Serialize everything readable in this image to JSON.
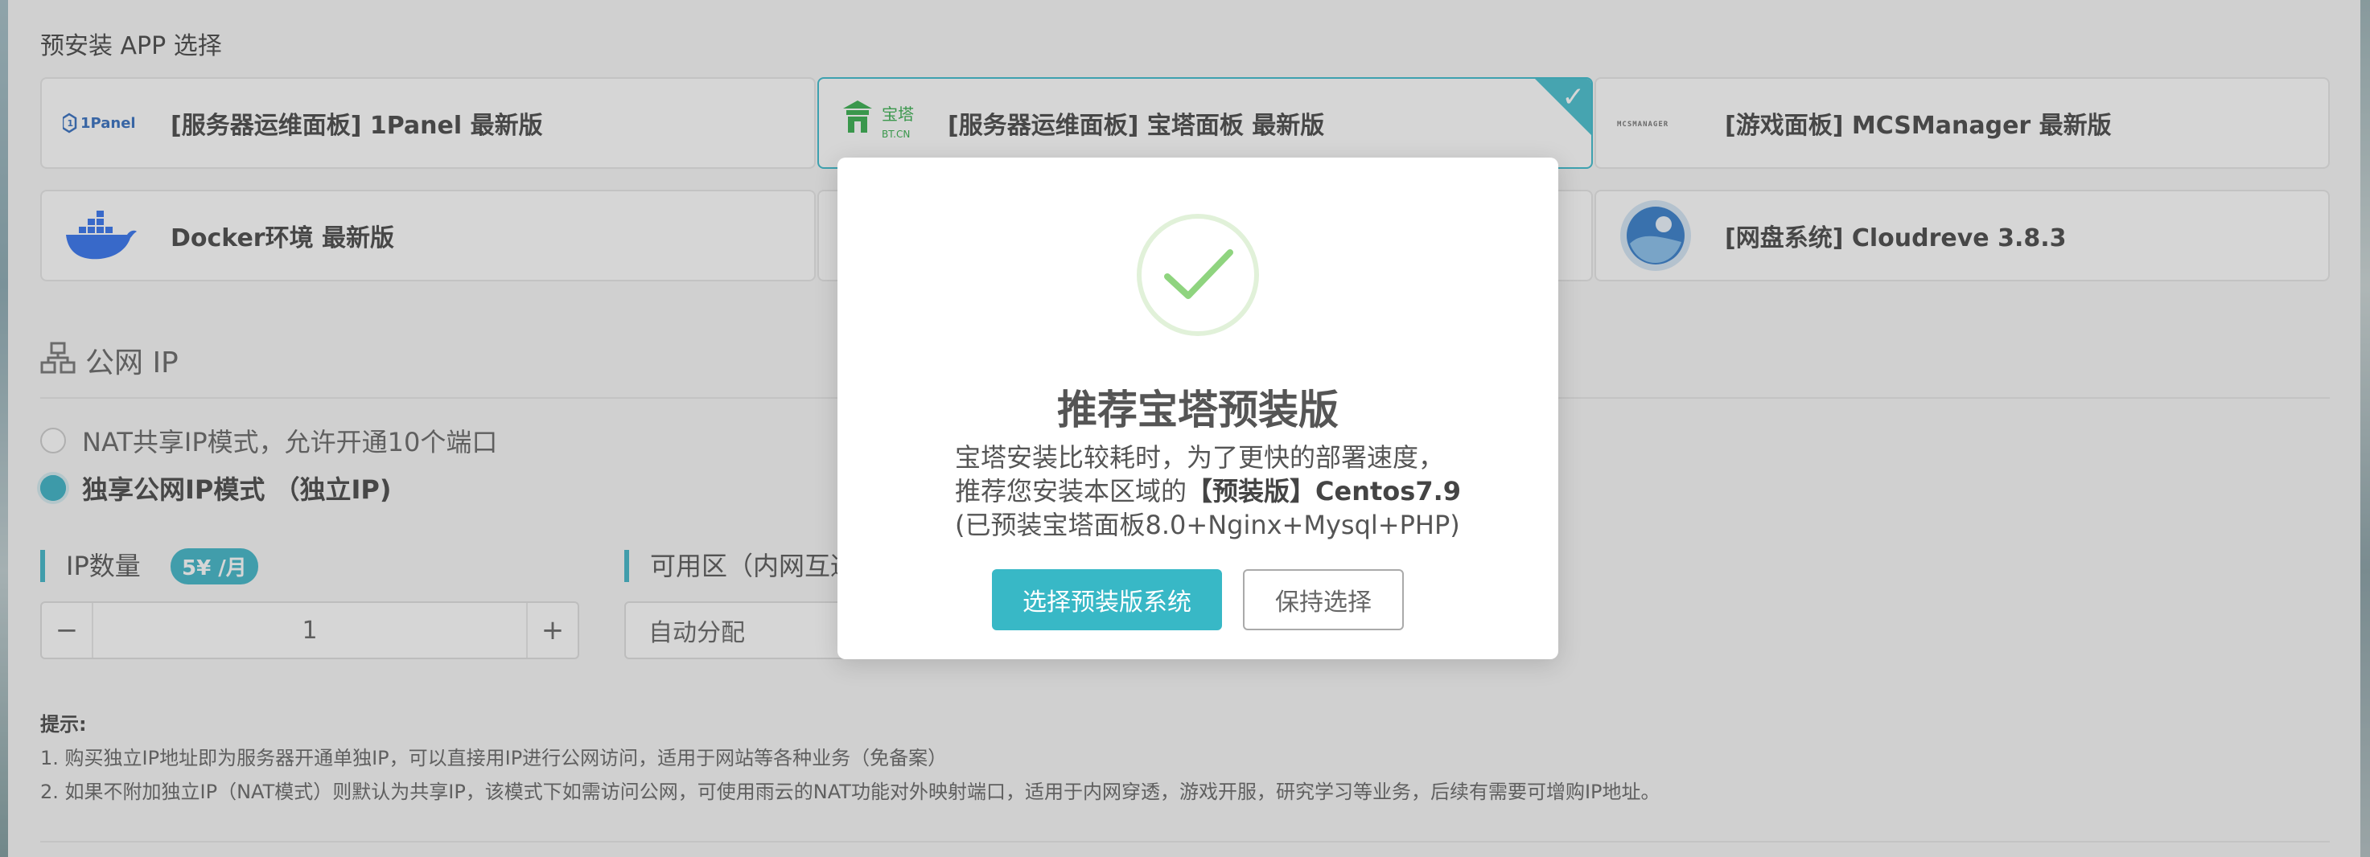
{
  "apps": {
    "section_title": "预安装 APP 选择",
    "items": [
      {
        "label": "[服务器运维面板] 1Panel 最新版",
        "logo_text": "1Panel",
        "selected": false
      },
      {
        "label": "[服务器运维面板] 宝塔面板 最新版",
        "logo_text": "宝塔",
        "logo_subtext": "BT.CN",
        "selected": true
      },
      {
        "label": "[游戏面板] MCSManager 最新版",
        "logo_text": "MCSMANAGER",
        "selected": false
      },
      {
        "label": "Docker环境 最新版",
        "selected": false
      },
      {
        "label": "",
        "selected": false
      },
      {
        "label": "[网盘系统] Cloudreve 3.8.3",
        "selected": false
      }
    ]
  },
  "public_ip": {
    "title": "公网 IP",
    "options": [
      {
        "label": "NAT共享IP模式，允许开通10个端口",
        "checked": false
      },
      {
        "label": "独享公网IP模式 （独立IP)",
        "checked": true
      }
    ],
    "ip_count_label": "IP数量",
    "price_badge": "5¥ /月",
    "quantity": "1",
    "stepper_minus": "−",
    "stepper_plus": "+",
    "zone_label": "可用区（内网互通",
    "zone_value": "自动分配"
  },
  "tips": {
    "title": "提示:",
    "lines": [
      "1. 购买独立IP地址即为服务器开通单独IP，可以直接用IP进行公网访问，适用于网站等各种业务（免备案）",
      "2. 如果不附加独立IP（NAT模式）则默认为共享IP，该模式下如需访问公网，可使用雨云的NAT功能对外映射端口，适用于内网穿透，游戏开服，研究学习等业务，后续有需要可增购IP地址。"
    ]
  },
  "modal": {
    "title": "推荐宝塔预装版",
    "line1": "宝塔安装比较耗时，为了更快的部署速度，",
    "line2_prefix": "推荐您安装本区域的",
    "line2_bold": "【预装版】Centos7.9",
    "line3": "(已预装宝塔面板8.0+Nginx+Mysql+PHP)",
    "primary_button": "选择预装版系统",
    "secondary_button": "保持选择"
  },
  "colors": {
    "accent": "#2aaec2",
    "primary_button": "#38b8c6",
    "success_check": "#7ed07a",
    "baota_green": "#20a53a",
    "docker_blue": "#1d63ed"
  }
}
